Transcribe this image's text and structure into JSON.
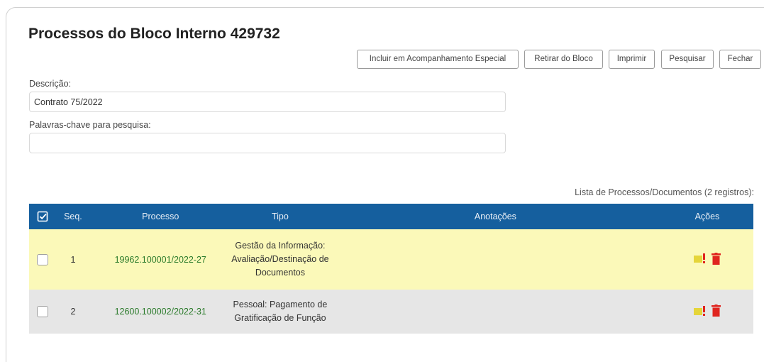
{
  "page": {
    "title": "Processos do Bloco Interno 429732"
  },
  "toolbar": {
    "buttons": [
      {
        "label": "Incluir em Acompanhamento Especial"
      },
      {
        "label": "Retirar do Bloco"
      },
      {
        "label": "Imprimir"
      },
      {
        "label": "Pesquisar"
      },
      {
        "label": "Fechar"
      }
    ]
  },
  "form": {
    "descricao_label": "Descrição:",
    "descricao_value": "Contrato 75/2022",
    "palavras_label": "Palavras-chave para pesquisa:",
    "palavras_value": ""
  },
  "table": {
    "caption": "Lista de Processos/Documentos (2 registros):",
    "headers": {
      "seq": "Seq.",
      "processo": "Processo",
      "tipo": "Tipo",
      "anotacoes": "Anotações",
      "acoes": "Ações"
    },
    "rows": [
      {
        "seq": "1",
        "processo": "19962.100001/2022-27",
        "tipo": "Gestão da Informação: Avaliação/Destinação de Documentos",
        "anotacoes": ""
      },
      {
        "seq": "2",
        "processo": "12600.100002/2022-31",
        "tipo": "Pessoal: Pagamento de Gratificação de Função",
        "anotacoes": ""
      }
    ]
  },
  "icons": {
    "header_checkbox": "check-square-icon",
    "annotation": "note-alert-icon",
    "remove": "trash-icon"
  },
  "colors": {
    "header_bg": "#155f9e",
    "row_highlight": "#fbf9b9",
    "row_alt": "#e6e6e6",
    "process_link": "#2a7a2a",
    "trash": "#e0251f",
    "note_yellow": "#e5d53a"
  }
}
